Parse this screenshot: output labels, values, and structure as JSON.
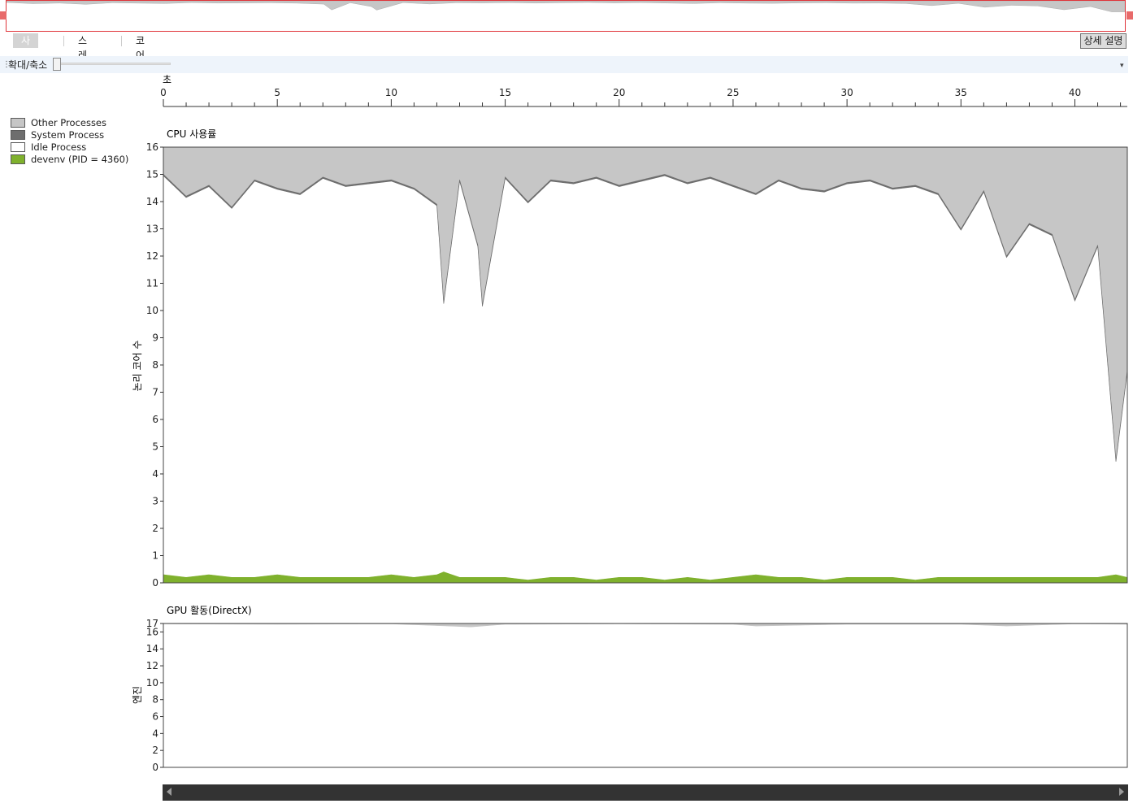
{
  "tabs": [
    {
      "label": "사용률",
      "active": true
    },
    {
      "label": "스레드",
      "active": false
    },
    {
      "label": "코어",
      "active": false
    }
  ],
  "details_button": "상세 설명",
  "zoom": {
    "label": "확대/축소",
    "level": 0
  },
  "legend": [
    {
      "name": "Other Processes",
      "color": "#c6c6c6"
    },
    {
      "name": "System Process",
      "color": "#6e6e6e"
    },
    {
      "name": "Idle Process",
      "color": "#ffffff"
    },
    {
      "name": "devenv (PID = 4360)",
      "color": "#7fb12d"
    }
  ],
  "time_axis": {
    "label": "초",
    "ticks": [
      "0",
      "5",
      "10",
      "15",
      "20",
      "25",
      "30",
      "35",
      "40"
    ]
  },
  "chart_data": [
    {
      "type": "area",
      "title": "CPU 사용률",
      "ylabel": "논리 코어 수",
      "xlim": [
        0,
        42.3
      ],
      "ylim": [
        0,
        16
      ],
      "yticks": [
        "0",
        "1",
        "2",
        "3",
        "4",
        "5",
        "6",
        "7",
        "8",
        "9",
        "10",
        "11",
        "12",
        "13",
        "14",
        "15",
        "16"
      ],
      "x": [
        0,
        1,
        2,
        3,
        4,
        5,
        6,
        7,
        8,
        9,
        10,
        11,
        12,
        12.3,
        13,
        13.8,
        14,
        15,
        16,
        17,
        18,
        19,
        20,
        21,
        22,
        23,
        24,
        25,
        26,
        27,
        28,
        29,
        30,
        31,
        32,
        33,
        34,
        35,
        36,
        37,
        38,
        39,
        40,
        41,
        41.8,
        42.3
      ],
      "series": [
        {
          "name": "devenv (PID = 4360)",
          "color": "#7fb12d",
          "values": [
            0.3,
            0.2,
            0.3,
            0.2,
            0.2,
            0.3,
            0.2,
            0.2,
            0.2,
            0.2,
            0.3,
            0.2,
            0.3,
            0.4,
            0.2,
            0.2,
            0.2,
            0.2,
            0.1,
            0.2,
            0.2,
            0.1,
            0.2,
            0.2,
            0.1,
            0.2,
            0.1,
            0.2,
            0.3,
            0.2,
            0.2,
            0.1,
            0.2,
            0.2,
            0.2,
            0.1,
            0.2,
            0.2,
            0.2,
            0.2,
            0.2,
            0.2,
            0.2,
            0.2,
            0.3,
            0.2
          ]
        },
        {
          "name": "Other Processes",
          "color": "#c6c6c6",
          "values": [
            15.0,
            14.2,
            14.6,
            13.8,
            14.8,
            14.5,
            14.3,
            14.9,
            14.6,
            14.7,
            14.8,
            14.5,
            13.9,
            10.3,
            14.8,
            12.4,
            10.2,
            14.9,
            14.0,
            14.8,
            14.7,
            14.9,
            14.6,
            14.8,
            15.0,
            14.7,
            14.9,
            14.6,
            14.3,
            14.8,
            14.5,
            14.4,
            14.7,
            14.8,
            14.5,
            14.6,
            14.3,
            13.0,
            14.4,
            12.0,
            13.2,
            12.8,
            10.4,
            12.4,
            4.5,
            7.8
          ]
        },
        {
          "name": "System Process",
          "color": "#6e6e6e",
          "values": [
            0.05,
            0.05,
            0.05,
            0.05,
            0.05,
            0.05,
            0.05,
            0.05,
            0.05,
            0.05,
            0.05,
            0.05,
            0.05,
            0.05,
            0.05,
            0.05,
            0.05,
            0.05,
            0.05,
            0.05,
            0.05,
            0.05,
            0.05,
            0.05,
            0.05,
            0.05,
            0.05,
            0.05,
            0.05,
            0.05,
            0.05,
            0.05,
            0.05,
            0.05,
            0.05,
            0.05,
            0.05,
            0.05,
            0.05,
            0.05,
            0.05,
            0.05,
            0.05,
            0.05,
            0.05,
            0.05
          ]
        }
      ]
    },
    {
      "type": "area",
      "title": "GPU 활동(DirectX)",
      "ylabel": "엔진",
      "xlim": [
        0,
        42.3
      ],
      "ylim": [
        0,
        17
      ],
      "yticks": [
        "0",
        "2",
        "4",
        "6",
        "8",
        "10",
        "12",
        "14",
        "16",
        "17"
      ],
      "x": [
        0,
        5,
        10,
        12.5,
        13.5,
        15,
        20,
        25,
        26,
        30,
        35,
        37,
        40,
        42.3
      ],
      "series": [
        {
          "name": "Other Processes",
          "color": "#c6c6c6",
          "values": [
            16.95,
            16.9,
            16.95,
            16.7,
            16.6,
            16.9,
            16.95,
            16.9,
            16.7,
            16.9,
            16.9,
            16.7,
            16.95,
            16.9
          ]
        }
      ]
    }
  ]
}
